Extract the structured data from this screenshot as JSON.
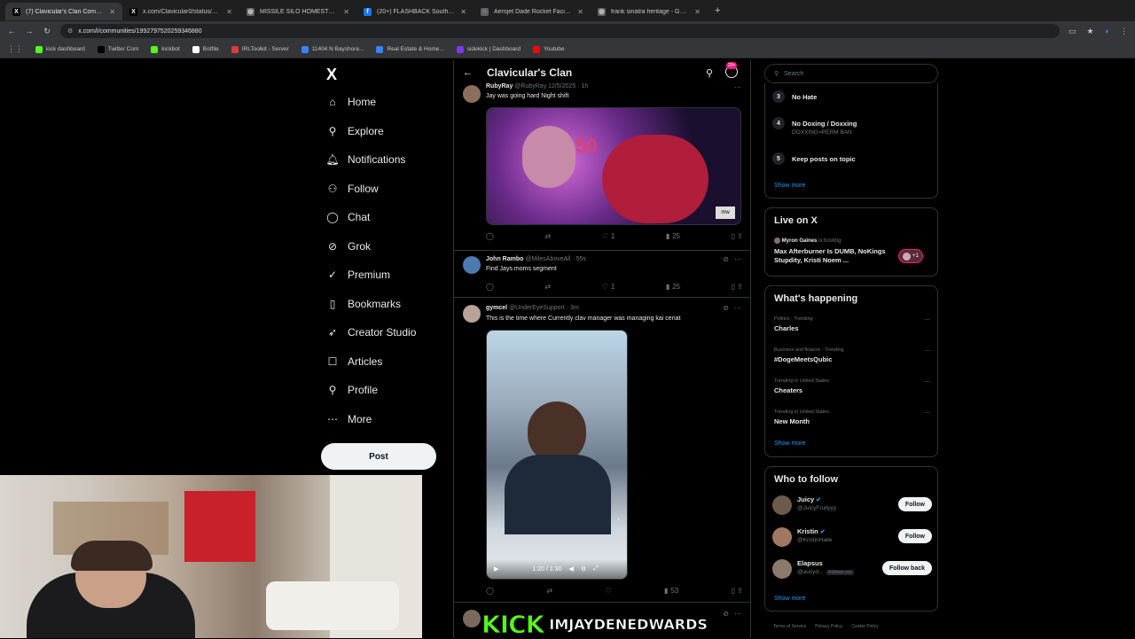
{
  "browser": {
    "tabs": [
      {
        "title": "(7) Clavicular's Clan Communit",
        "color": "#000000",
        "glyph": "X",
        "active": true
      },
      {
        "title": "x.com/Clavicular0/status/2039",
        "color": "#000000",
        "glyph": "X",
        "active": false
      },
      {
        "title": "MISSILE SILO HOMESTEAD - G",
        "color": "#5f6368",
        "glyph": "◎",
        "active": false
      },
      {
        "title": "(20+) FLASHBACK South Florid",
        "color": "#1877f2",
        "glyph": "f",
        "active": false
      },
      {
        "title": "Aerojet Dade Rocket Facility | A",
        "color": "#5f6368",
        "glyph": "◌",
        "active": false
      },
      {
        "title": "frank sinatra heritage - Googl",
        "color": "#5f6368",
        "glyph": "◎",
        "active": false
      }
    ],
    "url": "x.com/i/communities/1992797520259346880",
    "bookmarks": [
      {
        "label": "kick dashboard",
        "color": "#53fc18"
      },
      {
        "label": "Twitter Com",
        "color": "#000000"
      },
      {
        "label": "kickbot",
        "color": "#53fc18"
      },
      {
        "label": "Botfile",
        "color": "#ffffff"
      },
      {
        "label": "IRLToolkit - Server",
        "color": "#e03a3a"
      },
      {
        "label": "11404 N Bayshore...",
        "color": "#3b82f6"
      },
      {
        "label": "Real Estate & Home...",
        "color": "#3b82f6"
      },
      {
        "label": "sidekick | Dashboard",
        "color": "#7c3aed"
      },
      {
        "label": "Youtube",
        "color": "#ff0000"
      }
    ]
  },
  "nav": {
    "items": [
      {
        "label": "Home",
        "icon": "⌂",
        "name": "home"
      },
      {
        "label": "Explore",
        "icon": "⚲",
        "name": "explore"
      },
      {
        "label": "Notifications",
        "icon": "🔔︎",
        "name": "notifications"
      },
      {
        "label": "Follow",
        "icon": "⚇",
        "name": "follow"
      },
      {
        "label": "Chat",
        "icon": "◯",
        "name": "chat"
      },
      {
        "label": "Grok",
        "icon": "⊘",
        "name": "grok"
      },
      {
        "label": "Premium",
        "icon": "✓",
        "name": "premium"
      },
      {
        "label": "Bookmarks",
        "icon": "▯",
        "name": "bookmarks"
      },
      {
        "label": "Creator Studio",
        "icon": "➶",
        "name": "creator-studio"
      },
      {
        "label": "Articles",
        "icon": "☐",
        "name": "articles"
      },
      {
        "label": "Profile",
        "icon": "⚲",
        "name": "profile"
      },
      {
        "label": "More",
        "icon": "⋯",
        "name": "more"
      }
    ],
    "post_label": "Post"
  },
  "main": {
    "title": "Clavicular's Clan",
    "badge": "20+",
    "tweets": [
      {
        "name": "RubyRay",
        "handle": "@RubyRay 12/5/2025 · 1h",
        "text": "Jay was going hard Night shift",
        "likes": "1",
        "views": "25"
      },
      {
        "name": "John Rambo",
        "handle": "@MilesAboveAll · 55s",
        "text": "Find Jays moms segment",
        "likes": "1",
        "views": "25"
      },
      {
        "name": "gymcel",
        "handle": "@UnderEyeSupport · 3m",
        "text": "This is the time where Currently clav manager was managing kai cenat",
        "video_time": "1:20 / 1:30",
        "views": "53"
      }
    ]
  },
  "right": {
    "search_placeholder": "Search",
    "rules": [
      {
        "num": "3",
        "title": "No Hate",
        "sub": ""
      },
      {
        "num": "4",
        "title": "No Doxing / Doxxing",
        "sub": "DOXXING=PERM BAN"
      },
      {
        "num": "5",
        "title": "Keep posts on topic",
        "sub": ""
      }
    ],
    "show_more": "Show more",
    "live": {
      "title": "Live on X",
      "host": "Myron Gaines",
      "host_status": "is hosting",
      "text": "Max Afterburner Is DUMB, NoKings Stupdity, Kristi Noem ...",
      "count": "+1"
    },
    "happening": {
      "title": "What's happening",
      "trends": [
        {
          "cat": "Politics · Trending",
          "name": "Charles"
        },
        {
          "cat": "Business and finance · Trending",
          "name": "#DogeMeetsQubic"
        },
        {
          "cat": "Trending in United States",
          "name": "Cheaters"
        },
        {
          "cat": "Trending in United States",
          "name": "New Month"
        }
      ]
    },
    "who": {
      "title": "Who to follow",
      "people": [
        {
          "name": "Juicy",
          "handle": "@JuicyFruityyy",
          "btn": "Follow",
          "color": "#6b5b4a"
        },
        {
          "name": "Kristin",
          "handle": "@KristinHaile",
          "btn": "Follow",
          "color": "#a07862"
        },
        {
          "name": "Elapsus",
          "handle": "@ausyd...",
          "follows": "Follows you",
          "btn": "Follow back",
          "color": "#8a7a6a"
        }
      ]
    },
    "footer": [
      "Terms of Service",
      "Privacy Policy",
      "Cookie Policy"
    ]
  },
  "overlay": {
    "kick": "KICK",
    "user": "IMJAYDENEDWARDS"
  }
}
